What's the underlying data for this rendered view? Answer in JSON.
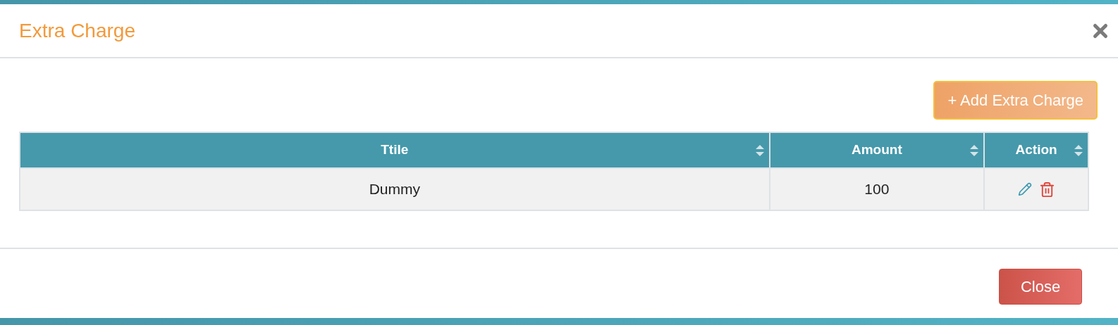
{
  "modal": {
    "title": "Extra Charge"
  },
  "add_button": {
    "label": "+ Add Extra Charge"
  },
  "table": {
    "columns": [
      {
        "label": "Ttile"
      },
      {
        "label": "Amount"
      },
      {
        "label": "Action"
      }
    ],
    "rows": [
      {
        "title": "Dummy",
        "amount": "100"
      }
    ]
  },
  "footer": {
    "buttons": [
      {
        "label": "Close"
      }
    ]
  }
}
